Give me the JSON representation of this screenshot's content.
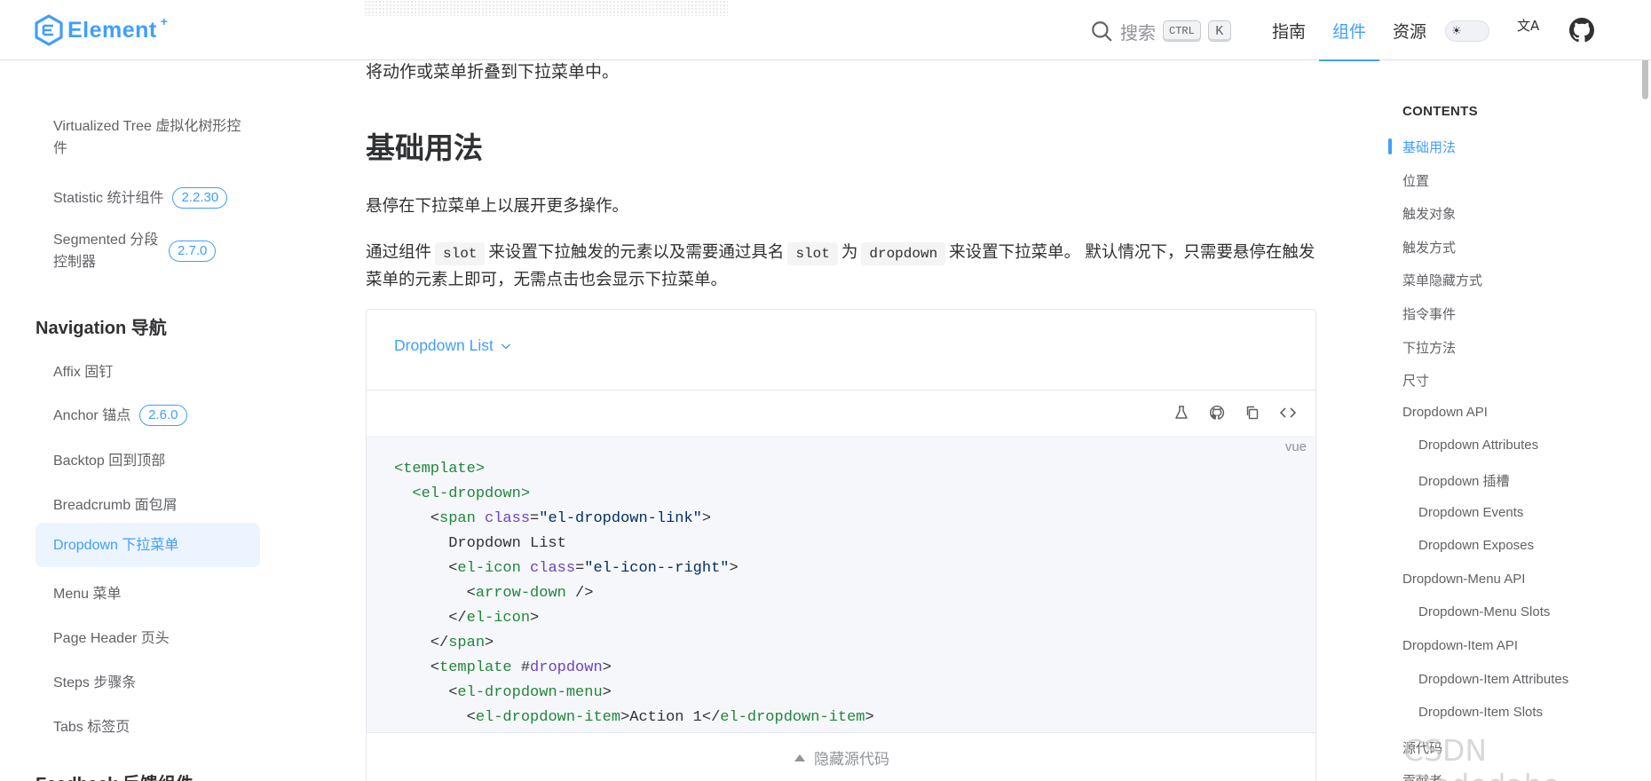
{
  "header": {
    "logo_text": "Element",
    "logo_sup": "+",
    "search_label": "搜索",
    "kbd_ctrl": "CTRL",
    "kbd_k": "K",
    "nav": [
      {
        "label": "指南",
        "active": false
      },
      {
        "label": "组件",
        "active": true
      },
      {
        "label": "资源",
        "active": false
      }
    ],
    "lang_icon": "文A"
  },
  "sidebar": {
    "items_top": [
      {
        "label": "Virtualized Tree 虚拟化树形控件",
        "badge": ""
      },
      {
        "label": "Statistic 统计组件",
        "badge": "2.2.30"
      },
      {
        "label": "Segmented 分段控制器",
        "badge": "2.7.0"
      }
    ],
    "group_navigation": "Navigation 导航",
    "items_nav": [
      {
        "label": "Affix 固钉",
        "badge": ""
      },
      {
        "label": "Anchor 锚点",
        "badge": "2.6.0"
      },
      {
        "label": "Backtop 回到顶部",
        "badge": ""
      },
      {
        "label": "Breadcrumb 面包屑",
        "badge": ""
      },
      {
        "label": "Dropdown 下拉菜单",
        "badge": "",
        "active": true
      },
      {
        "label": "Menu 菜单",
        "badge": ""
      },
      {
        "label": "Page Header 页头",
        "badge": ""
      },
      {
        "label": "Steps 步骤条",
        "badge": ""
      },
      {
        "label": "Tabs 标签页",
        "badge": ""
      }
    ],
    "group_feedback": "Feedback 反馈组件"
  },
  "main": {
    "intro": "将动作或菜单折叠到下拉菜单中。",
    "heading": "基础用法",
    "p1": "悬停在下拉菜单上以展开更多操作。",
    "p2": {
      "t1": "通过组件",
      "c1": "slot",
      "t2": "来设置下拉触发的元素以及需要通过具名",
      "c2": "slot",
      "t3": "为",
      "c3": "dropdown",
      "t4": "来设置下拉菜单。 默认情况下，只需要悬停在触发菜单的元素上即可，无需点击也会显示下拉菜单。"
    },
    "demo": {
      "dropdown_label": "Dropdown List",
      "code_lang": "vue",
      "hide_code": "隐藏源代码"
    }
  },
  "toc": {
    "title": "CONTENTS",
    "items": [
      {
        "label": "基础用法",
        "level": 1,
        "active": true
      },
      {
        "label": "位置",
        "level": 1
      },
      {
        "label": "触发对象",
        "level": 1
      },
      {
        "label": "触发方式",
        "level": 1
      },
      {
        "label": "菜单隐藏方式",
        "level": 1
      },
      {
        "label": "指令事件",
        "level": 1
      },
      {
        "label": "下拉方法",
        "level": 1
      },
      {
        "label": "尺寸",
        "level": 1
      },
      {
        "label": "Dropdown API",
        "level": 1
      },
      {
        "label": "Dropdown Attributes",
        "level": 2
      },
      {
        "label": "Dropdown 插槽",
        "level": 2
      },
      {
        "label": "Dropdown Events",
        "level": 2
      },
      {
        "label": "Dropdown Exposes",
        "level": 2
      },
      {
        "label": "Dropdown-Menu API",
        "level": 1
      },
      {
        "label": "Dropdown-Menu Slots",
        "level": 2
      },
      {
        "label": "Dropdown-Item API",
        "level": 1
      },
      {
        "label": "Dropdown-Item Attributes",
        "level": 2
      },
      {
        "label": "Dropdown-Item Slots",
        "level": 2
      },
      {
        "label": "源代码",
        "level": 1
      },
      {
        "label": "贡献者",
        "level": 1
      }
    ]
  },
  "watermark": "CSDN @ededabo",
  "colors": {
    "accent": "#409eff",
    "text": "#303133",
    "muted": "#606266"
  }
}
